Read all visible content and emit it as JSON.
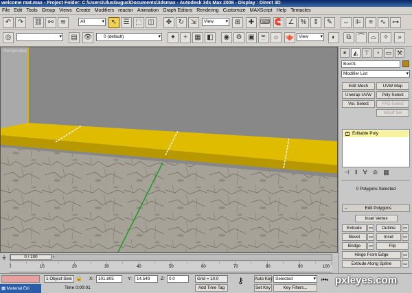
{
  "window": {
    "title": "welcome mat.max - Project Folder: C:\\Users\\UlusGugus\\Documents\\3dsmax - Autodesk 3ds Max 2008 - Display : Direct 3D"
  },
  "menu": [
    "File",
    "Edit",
    "Tools",
    "Group",
    "Views",
    "Create",
    "Modifiers",
    "reactor",
    "Animation",
    "Graph Editors",
    "Rendering",
    "Customize",
    "MAXScript",
    "Help",
    "Tentacles"
  ],
  "toolbar": {
    "selection_filter": "All",
    "reference_coord": "View",
    "layer": "0 (default)",
    "reference_coord_2": "View"
  },
  "viewport": {
    "label": "Perspective",
    "colors": {
      "wall": "#878787",
      "mat_top": "#e6c200",
      "mat_front": "#a88a00",
      "floor": "#9e9a90",
      "edge_green": "#1e9a1e"
    }
  },
  "command_panel": {
    "object_name": "Box01",
    "modifier_list": "Modifier List",
    "buttons": [
      [
        "Edit Mesh",
        "UVW Map"
      ],
      [
        "Unwrap UVW",
        "Poly Select"
      ],
      [
        "Vol. Select",
        "FFD Select"
      ],
      [
        "",
        "NSurf Sel"
      ]
    ],
    "stack_item": "Editable Poly",
    "polygons_selected": "0 Polygons Selected",
    "rollout_title": "Edit Polygons",
    "inset_vertex": "Inset Vertex",
    "edit_buttons": [
      [
        "Extrude",
        "Outline"
      ],
      [
        "Bevel",
        "Inset"
      ],
      [
        "Bridge",
        "Flip"
      ]
    ],
    "hinge": "Hinge From Edge",
    "extrude_spline": "Extrude Along Spline"
  },
  "timeline": {
    "frame": "0 / 100",
    "ticks": [
      "0",
      "10",
      "20",
      "30",
      "40",
      "50",
      "60",
      "70",
      "80",
      "90",
      "100"
    ]
  },
  "status": {
    "selected": "1 Object Sele",
    "x_label": "X:",
    "x_value": "101.805",
    "y_label": "Y:",
    "y_value": "14.549",
    "z_label": "Z:",
    "z_value": "0.0",
    "grid": "Grid = 10.0",
    "auto_key": "Auto Key",
    "auto_key_mode": "Selected",
    "set_key": "Set Key",
    "key_filters": "Key Filters...",
    "taskbar": "Material Edi",
    "time": "Time  0:00:01",
    "add_time_tag": "Add Time Tag"
  },
  "watermark": "pxleyes.com"
}
